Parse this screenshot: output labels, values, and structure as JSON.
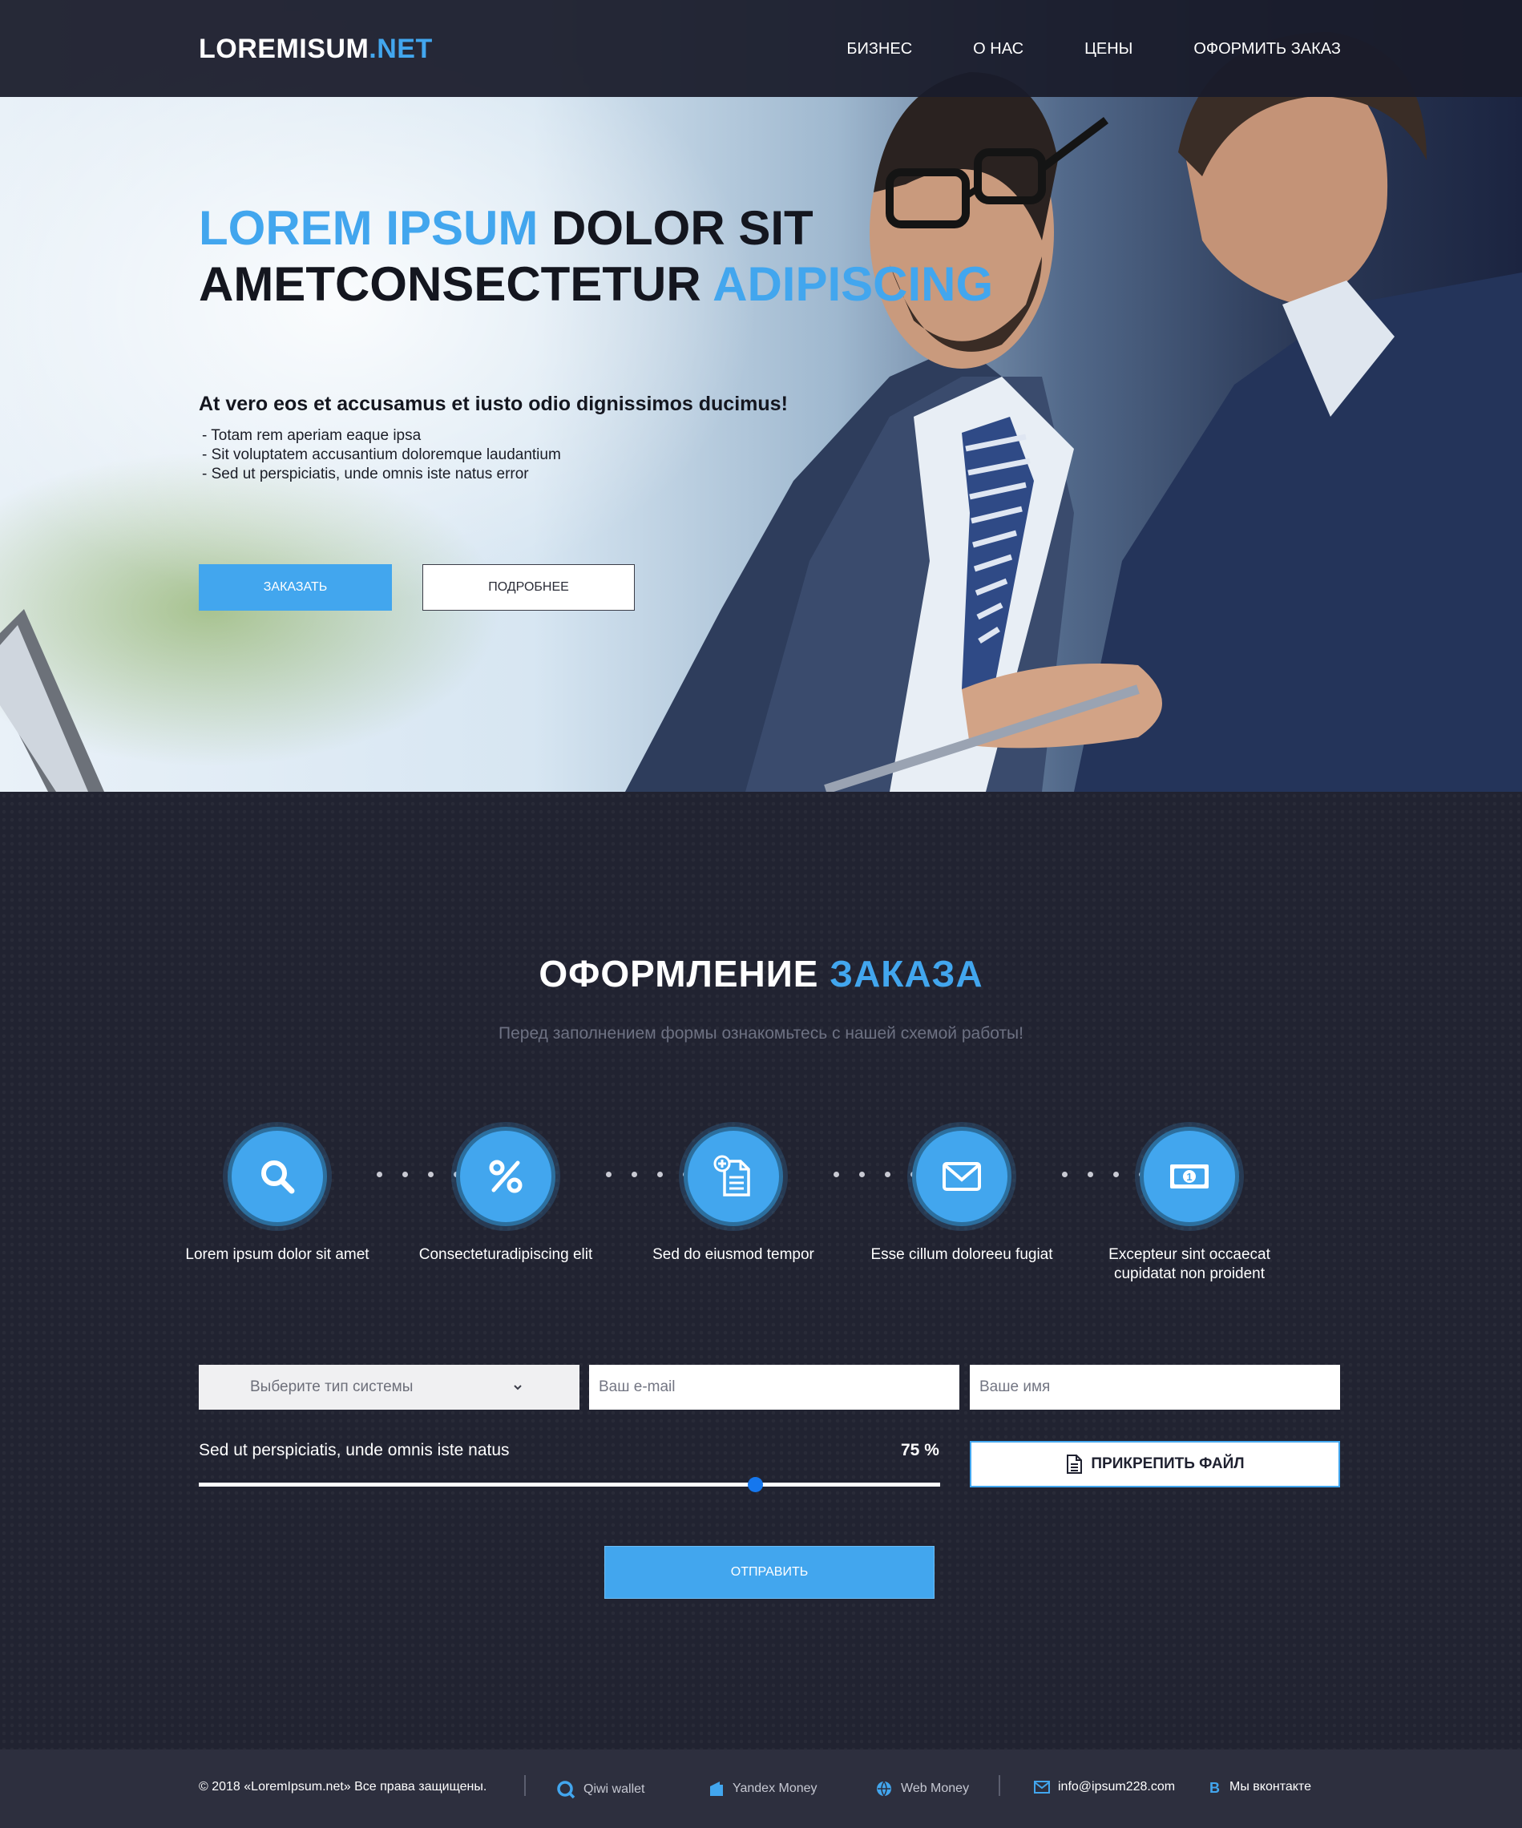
{
  "brand": {
    "logo_main": "LOREMISUM",
    "logo_accent": ".NET",
    "accent_color": "#42a6ee"
  },
  "nav": {
    "items": [
      "БИЗНЕС",
      "О НАС",
      "ЦЕНЫ",
      "ОФОРМИТЬ ЗАКАЗ"
    ]
  },
  "hero": {
    "title_line1_blue": "LOREM IPSUM",
    "title_line1_dark": " DOLOR SIT",
    "title_line2_dark": "AMETCONSECTETUR ",
    "title_line2_blue": "ADIPISCING",
    "subtitle": "At vero eos et accusamus et iusto odio dignissimos ducimus!",
    "list": [
      "- Totam rem aperiam eaque ipsa",
      "- Sit voluptatem accusantium doloremque laudantium",
      "- Sed ut perspiciatis, unde omnis iste natus error"
    ],
    "btn_order": "ЗАКАЗАТЬ",
    "btn_more": "ПОДРОБНЕЕ"
  },
  "order": {
    "title_white": "ОФОРМЛЕНИЕ ",
    "title_blue": "ЗАКАЗА",
    "subtitle": "Перед заполнением формы ознакомьтесь с нашей схемой работы!",
    "steps": [
      {
        "icon": "search-icon",
        "label": "Lorem ipsum dolor sit amet"
      },
      {
        "icon": "percent-icon",
        "label": "Consecteturadipiscing elit"
      },
      {
        "icon": "document-add-icon",
        "label": "Sed do eiusmod tempor"
      },
      {
        "icon": "envelope-icon",
        "label": "Esse cillum doloreeu fugiat"
      },
      {
        "icon": "banknote-icon",
        "label": "Excepteur sint occaecat cupidatat non proident"
      }
    ],
    "select_label": "Выберите тип системы",
    "email_placeholder": "Ваш e-mail",
    "name_placeholder": "Ваше имя",
    "slider_label": "Sed ut perspiciatis, unde omnis iste natus",
    "slider_value_text": "75 %",
    "slider_fraction": 0.75,
    "attach_label": "ПРИКРЕПИТЬ ФАЙЛ",
    "submit_label": "ОТПРАВИТЬ"
  },
  "footer": {
    "copyright": "© 2018 «LoremIpsum.net» Все права защищены.",
    "qiwi": "Qiwi wallet",
    "yandex": "Yandex Money",
    "webmoney": "Web Money",
    "email": "info@ipsum228.com",
    "vk": "Мы вконтакте"
  }
}
